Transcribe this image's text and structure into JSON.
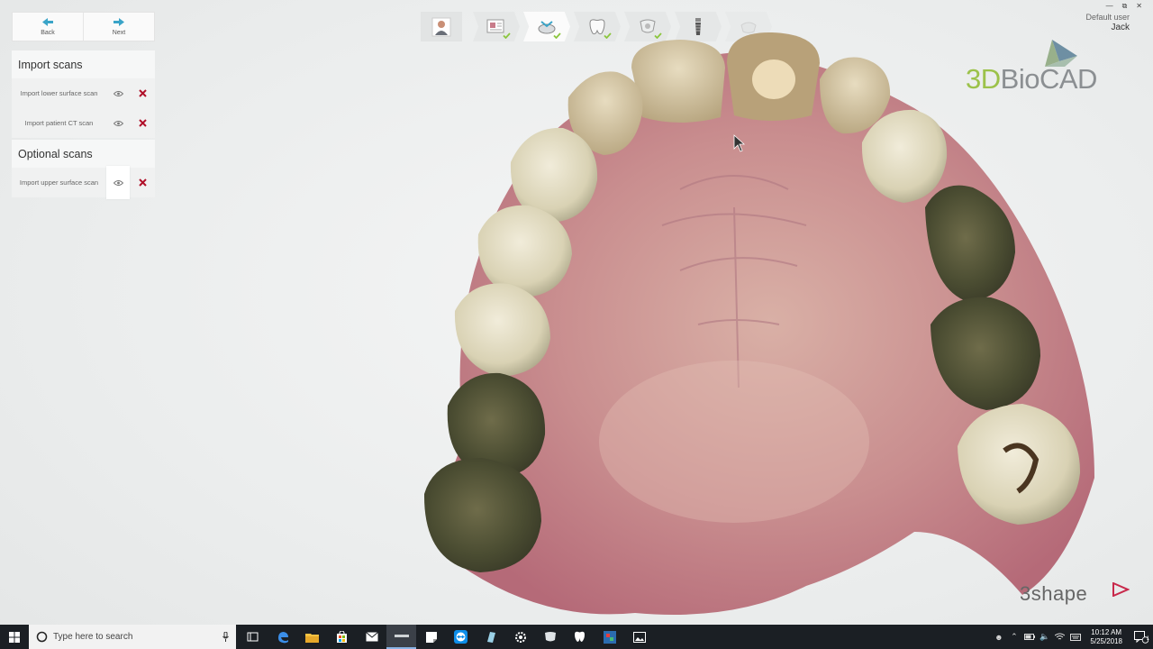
{
  "nav": {
    "back_label": "Back",
    "next_label": "Next"
  },
  "import_section": {
    "title": "Import scans",
    "items": [
      {
        "label": "Import lower surface scan"
      },
      {
        "label": "Import patient CT scan"
      }
    ]
  },
  "optional_section": {
    "title": "Optional scans",
    "items": [
      {
        "label": "Import upper surface scan"
      }
    ]
  },
  "workflow": {
    "steps": [
      {
        "icon": "patient-photo-icon",
        "completed": false
      },
      {
        "icon": "order-form-icon",
        "completed": true
      },
      {
        "icon": "scan-import-icon",
        "completed": true
      },
      {
        "icon": "tooth-icon",
        "completed": true
      },
      {
        "icon": "jaw-icon",
        "completed": true
      },
      {
        "icon": "implant-icon",
        "completed": false
      },
      {
        "icon": "surgical-guide-icon",
        "completed": false
      }
    ]
  },
  "user": {
    "role": "Default user",
    "name": "Jack"
  },
  "brand": {
    "prefix": "3D",
    "name": "BioCAD"
  },
  "vendor": {
    "name": "3shape"
  },
  "taskbar": {
    "search_placeholder": "Type here to search",
    "time": "10:12 AM",
    "date": "5/25/2018",
    "notification_count": "1"
  },
  "colors": {
    "accent": "#3aa4c8",
    "check": "#8cc63f",
    "delete": "#b0102a",
    "brand_green": "#9cc24a"
  }
}
